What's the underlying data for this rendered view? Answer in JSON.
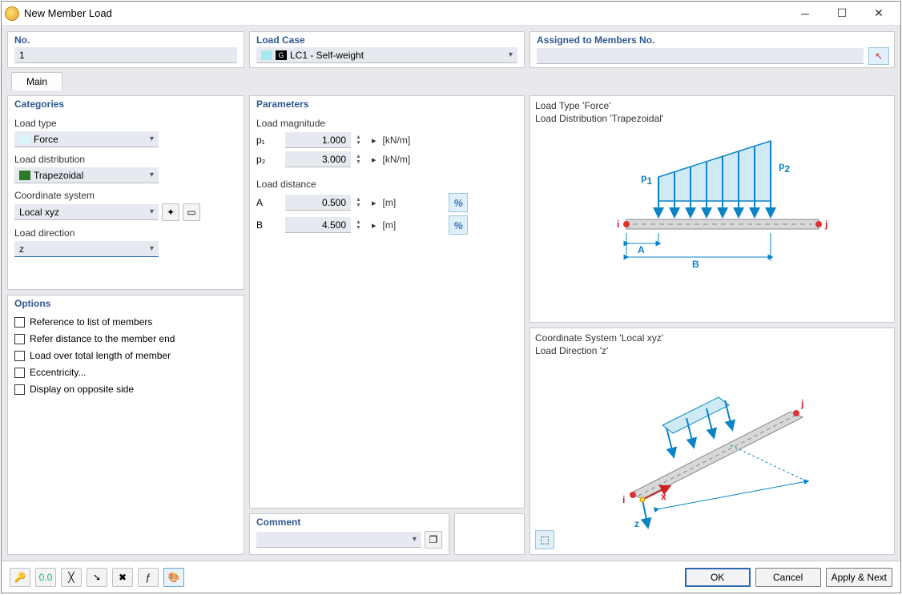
{
  "window": {
    "title": "New Member Load"
  },
  "top": {
    "no": {
      "label": "No.",
      "value": "1"
    },
    "lc": {
      "label": "Load Case",
      "value": "LC1 - Self-weight",
      "badge": "G"
    },
    "assign": {
      "label": "Assigned to Members No.",
      "value": ""
    }
  },
  "tab": {
    "main": "Main"
  },
  "categories": {
    "title": "Categories",
    "load_type_label": "Load type",
    "load_type_value": "Force",
    "load_distribution_label": "Load distribution",
    "load_distribution_value": "Trapezoidal",
    "coord_label": "Coordinate system",
    "coord_value": "Local xyz",
    "direction_label": "Load direction",
    "direction_value": "z"
  },
  "options": {
    "title": "Options",
    "opt1": "Reference to list of members",
    "opt2": "Refer distance to the member end",
    "opt3": "Load over total length of member",
    "opt4": "Eccentricity...",
    "opt5": "Display on opposite side"
  },
  "parameters": {
    "title": "Parameters",
    "mag_label": "Load magnitude",
    "p1_label": "p₁",
    "p1_value": "1.000",
    "p2_label": "p₂",
    "p2_value": "3.000",
    "kn_unit": "[kN/m]",
    "dist_label": "Load distance",
    "a_label": "A",
    "a_value": "0.500",
    "b_label": "B",
    "b_value": "4.500",
    "m_unit": "[m]",
    "pct": "%"
  },
  "diagram1": {
    "line1": "Load Type 'Force'",
    "line2": "Load Distribution 'Trapezoidal'",
    "p1": "p",
    "p1sub": "1",
    "p2": "p",
    "p2sub": "2",
    "i": "i",
    "j": "j",
    "A": "A",
    "B": "B"
  },
  "diagram2": {
    "line1": "Coordinate System 'Local xyz'",
    "line2": "Load Direction 'z'",
    "i": "i",
    "j": "j",
    "x": "x",
    "z": "z"
  },
  "comment": {
    "title": "Comment",
    "value": ""
  },
  "footer": {
    "ok": "OK",
    "cancel": "Cancel",
    "apply": "Apply & Next"
  }
}
